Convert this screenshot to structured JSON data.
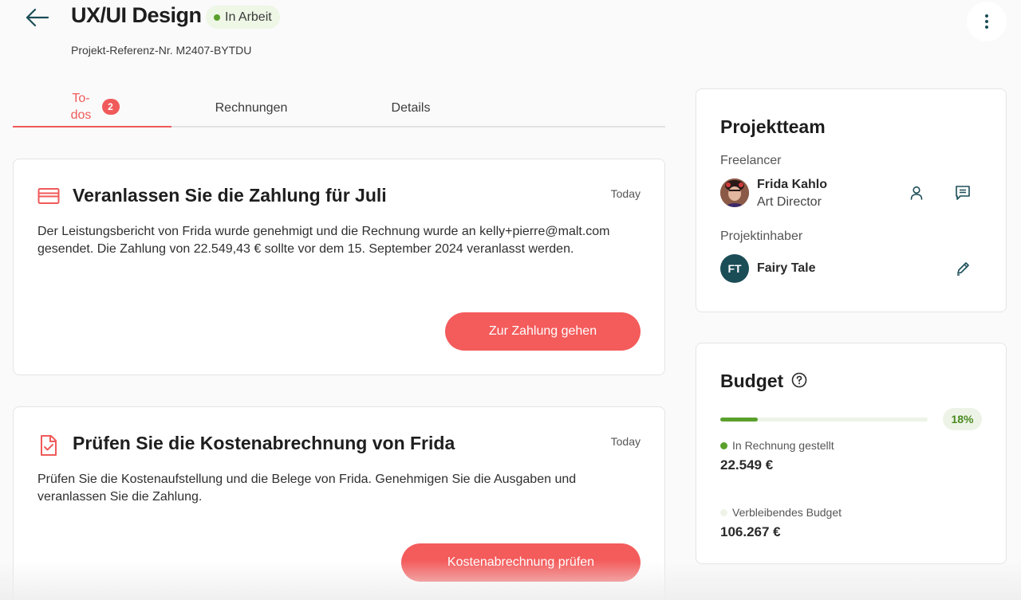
{
  "header": {
    "title": "UX/UI Design",
    "status": "In Arbeit",
    "reference": "Projekt-Referenz-Nr. M2407-BYTDU"
  },
  "tabs": [
    {
      "label": "To-dos",
      "badge": "2",
      "active": true
    },
    {
      "label": "Rechnungen",
      "active": false
    },
    {
      "label": "Details",
      "active": false
    }
  ],
  "todos": [
    {
      "icon": "credit-card-icon",
      "title": "Veranlassen Sie die Zahlung für Juli",
      "date": "Today",
      "text": "Der Leistungsbericht von Frida wurde genehmigt und die Rechnung wurde an kelly+pierre@malt.com gesendet. Die Zahlung von 22.549,43 € sollte vor dem 15. September 2024 veranlasst werden.",
      "button": "Zur Zahlung gehen"
    },
    {
      "icon": "document-check-icon",
      "title": "Prüfen Sie die Kostenabrechnung von Frida",
      "date": "Today",
      "text": "Prüfen Sie die Kostenaufstellung und die Belege von Frida. Genehmigen Sie die Ausgaben und veranlassen Sie die Zahlung.",
      "button": "Kostenabrechnung prüfen"
    }
  ],
  "team": {
    "title": "Projektteam",
    "freelancer_label": "Freelancer",
    "freelancer": {
      "name": "Frida Kahlo",
      "role": "Art Director"
    },
    "owner_label": "Projektinhaber",
    "owner": {
      "initials": "FT",
      "name": "Fairy Tale"
    }
  },
  "budget": {
    "title": "Budget",
    "progress_percent": 18,
    "progress_label": "18%",
    "invoiced_label": "In Rechnung gestellt",
    "invoiced_amount": "22.549 €",
    "remaining_label": "Verbleibendes Budget",
    "remaining_amount": "106.267 €"
  },
  "colors": {
    "accent": "#f45b5b",
    "status_green": "#5aa02c",
    "owner_avatar": "#1b4d57"
  }
}
